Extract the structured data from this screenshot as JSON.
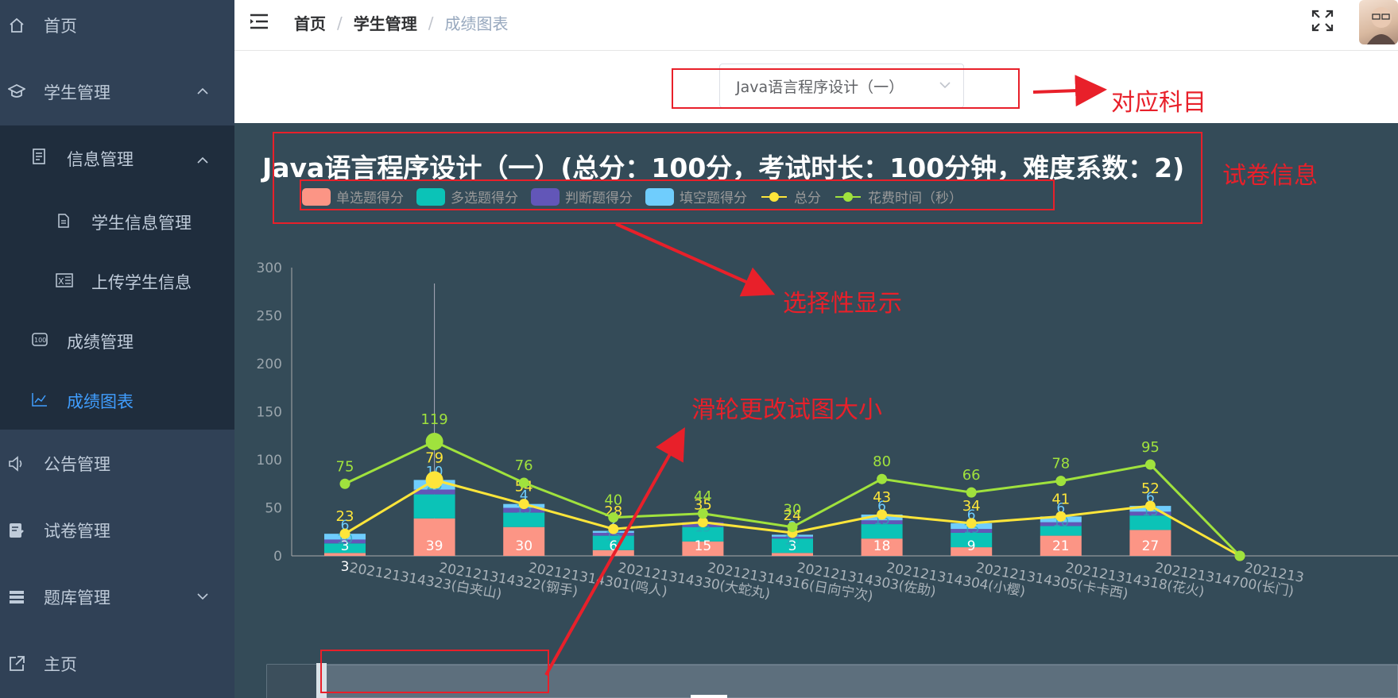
{
  "sidebar": {
    "items": [
      {
        "label": "首页"
      },
      {
        "label": "学生管理"
      },
      {
        "label": "信息管理"
      },
      {
        "label": "学生信息管理"
      },
      {
        "label": "上传学生信息"
      },
      {
        "label": "成绩管理"
      },
      {
        "label": "成绩图表"
      },
      {
        "label": "公告管理"
      },
      {
        "label": "试卷管理"
      },
      {
        "label": "题库管理"
      },
      {
        "label": "主页"
      }
    ]
  },
  "header": {
    "breadcrumb": [
      "首页",
      "学生管理",
      "成绩图表"
    ],
    "separator": "/"
  },
  "course_select": {
    "value": "Java语言程序设计（一）"
  },
  "annotations": {
    "subject": "对应科目",
    "paper_info": "试卷信息",
    "selective": "选择性显示",
    "wheel": "滑轮更改试图大小"
  },
  "colors": {
    "single": "#fc9585",
    "multi": "#0bc3b7",
    "judge": "#6256b8",
    "blank": "#6fcdfd",
    "total": "#fde53a",
    "time": "#a0e23d",
    "annotation": "#e8202a",
    "active_menu": "#409eff"
  },
  "chart_data": {
    "type": "bar",
    "title": "Java语言程序设计（一）(总分：100分，考试时长：100分钟，难度系数：2)",
    "legend": [
      "单选题得分",
      "多选题得分",
      "判断题得分",
      "填空题得分",
      "总分",
      "花费时间（秒）"
    ],
    "legend_position": "top-left",
    "grid": false,
    "ylim": [
      0,
      300
    ],
    "yticks": [
      "0",
      "50",
      "100",
      "150",
      "200",
      "250",
      "300"
    ],
    "categories": [
      "202121314323(白夹山)",
      "202121314323(白夹山)",
      "202121314322(钢手)",
      "202121314301(鸣人)",
      "202121314330(大蛇丸)",
      "202121314316(日向宁次)",
      "202121314303(佐助)",
      "202121314304(小樱)",
      "202121314305(卡卡西)",
      "202121314318(花火)",
      "202121314700(长门)"
    ],
    "x_tick_labels": [
      "3",
      "202121314323(白夹山)",
      "202121314322(钢手)",
      "202121314301(鸣人)",
      "202121314330(大蛇丸)",
      "202121314316(日向宁次)",
      "202121314303(佐助)",
      "202121314304(小樱)",
      "202121314305(卡卡西)",
      "202121314318(花火)",
      "202121314700(长门)",
      "2021213"
    ],
    "series": [
      {
        "name": "单选题得分",
        "type": "bar",
        "stack": "s",
        "values": [
          3,
          39,
          30,
          6,
          15,
          3,
          18,
          9,
          21,
          27,
          0
        ]
      },
      {
        "name": "多选题得分",
        "type": "bar",
        "stack": "s",
        "values": [
          10,
          25,
          15,
          15,
          15,
          15,
          15,
          15,
          10,
          15,
          0
        ]
      },
      {
        "name": "判断题得分",
        "type": "bar",
        "stack": "s",
        "values": [
          4,
          5,
          5,
          3,
          5,
          2,
          4,
          4,
          4,
          4,
          0
        ]
      },
      {
        "name": "填空题得分",
        "type": "bar",
        "stack": "s",
        "values": [
          6,
          10,
          4,
          2,
          0,
          2,
          6,
          6,
          6,
          6,
          0
        ]
      },
      {
        "name": "总分",
        "type": "line",
        "values": [
          23,
          79,
          54,
          28,
          35,
          24,
          43,
          34,
          41,
          52,
          0
        ]
      },
      {
        "name": "花费时间（秒）",
        "type": "line",
        "values": [
          75,
          119,
          76,
          40,
          44,
          30,
          80,
          66,
          78,
          95,
          0
        ]
      }
    ]
  }
}
